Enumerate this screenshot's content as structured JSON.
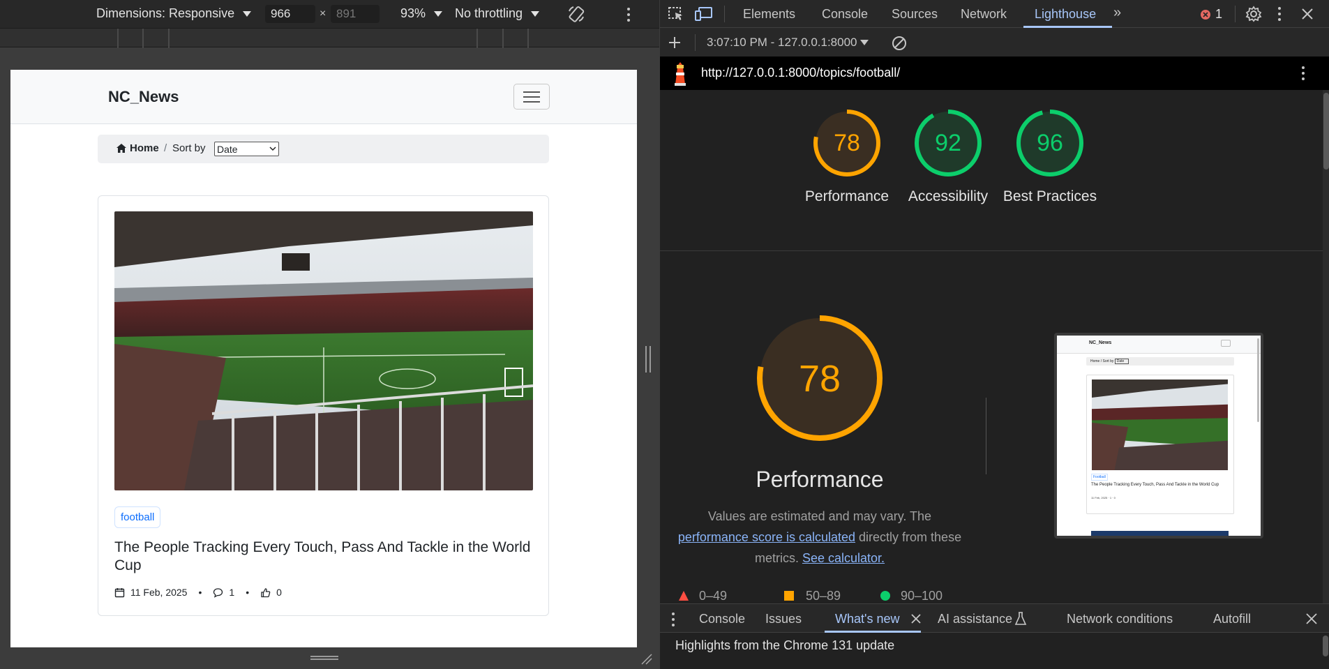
{
  "device_toolbar": {
    "dimensions_label": "Dimensions: Responsive",
    "width_value": "966",
    "height_value": "891",
    "zoom": "93%",
    "throttling": "No throttling"
  },
  "page": {
    "brand": "NC_News",
    "breadcrumb_home": "Home",
    "breadcrumb_sep": "/",
    "sort_label": "Sort by",
    "sort_selected": "Date",
    "article": {
      "topic": "football",
      "title": "The People Tracking Every Touch, Pass And Tackle in the World Cup",
      "date": "11 Feb, 2025",
      "comments": "1",
      "votes": "0",
      "sep": "•"
    }
  },
  "devtools": {
    "tabs": [
      "Elements",
      "Console",
      "Sources",
      "Network",
      "Lighthouse"
    ],
    "active_tab": "Lighthouse",
    "error_count": "1",
    "report_selector": "3:07:10 PM - 127.0.0.1:8000",
    "url": "http://127.0.0.1:8000/topics/football/",
    "scores": [
      {
        "label": "Performance",
        "score": 78,
        "color": "#ffa400"
      },
      {
        "label": "Accessibility",
        "score": 92,
        "color": "#0cce6b"
      },
      {
        "label": "Best Practices",
        "score": 96,
        "color": "#0cce6b"
      }
    ],
    "perf_big": {
      "score": "78",
      "title": "Performance",
      "desc_1": "Values are estimated and may vary. The",
      "link_1": "performance score is calculated",
      "desc_2": "directly from these",
      "desc_3": "metrics.",
      "link_2": "See calculator."
    },
    "legend": [
      {
        "range": "0–49",
        "color": "#ff4e42"
      },
      {
        "range": "50–89",
        "color": "#ffa400"
      },
      {
        "range": "90–100",
        "color": "#0cce6b"
      }
    ],
    "thumb": {
      "brand": "NC_News",
      "home": "Home",
      "sort": "Sort by",
      "sel": "Date",
      "topic": "Football",
      "title": "The People Tracking Every Touch, Pass And Tackle in the World Cup",
      "meta": "11 Feb, 2025 · 1 · 0"
    },
    "drawer_tabs": [
      "Console",
      "Issues",
      "What's new",
      "AI assistance",
      "Network conditions",
      "Autofill"
    ],
    "drawer_active": "What's new",
    "drawer_message": "Highlights from the Chrome 131 update"
  }
}
